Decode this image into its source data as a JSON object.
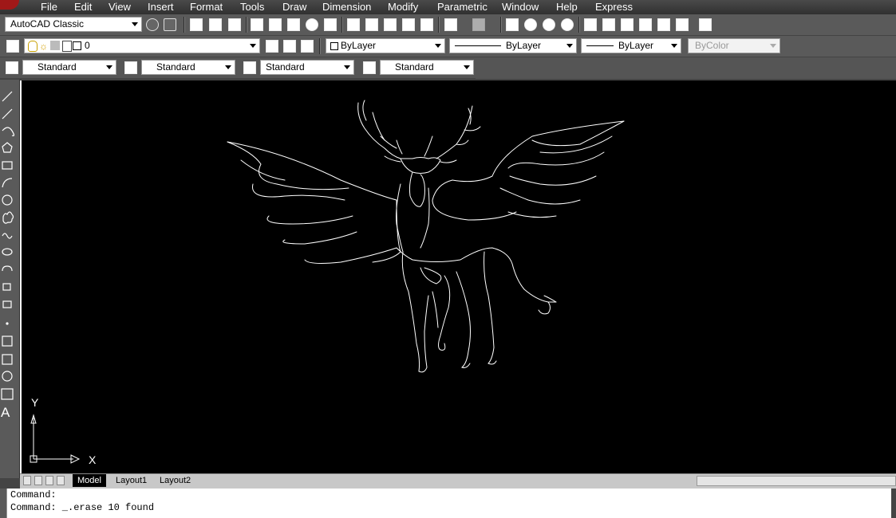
{
  "menubar": {
    "items": [
      "File",
      "Edit",
      "View",
      "Insert",
      "Format",
      "Tools",
      "Draw",
      "Dimension",
      "Modify",
      "Parametric",
      "Window",
      "Help",
      "Express"
    ]
  },
  "workspace": {
    "value": "AutoCAD Classic"
  },
  "layer": {
    "value": "0"
  },
  "properties": {
    "color": "ByLayer",
    "linetype": "ByLayer",
    "lineweight": "ByLayer",
    "plotstyle": "ByColor"
  },
  "styles": {
    "text_style": "Standard",
    "dim_style": "Standard",
    "table_style": "Standard",
    "mleader_style": "Standard"
  },
  "ucs": {
    "y_label": "Y",
    "x_label": "X"
  },
  "tabs": {
    "model": "Model",
    "layout1": "Layout1",
    "layout2": "Layout2"
  },
  "command_line": {
    "line1": "Command:",
    "line2": "Command:  _.erase 10 found"
  },
  "colors": {
    "canvas": "#000000",
    "drawing_lines": "#ffffff",
    "toolbar": "#5a5a5a"
  }
}
